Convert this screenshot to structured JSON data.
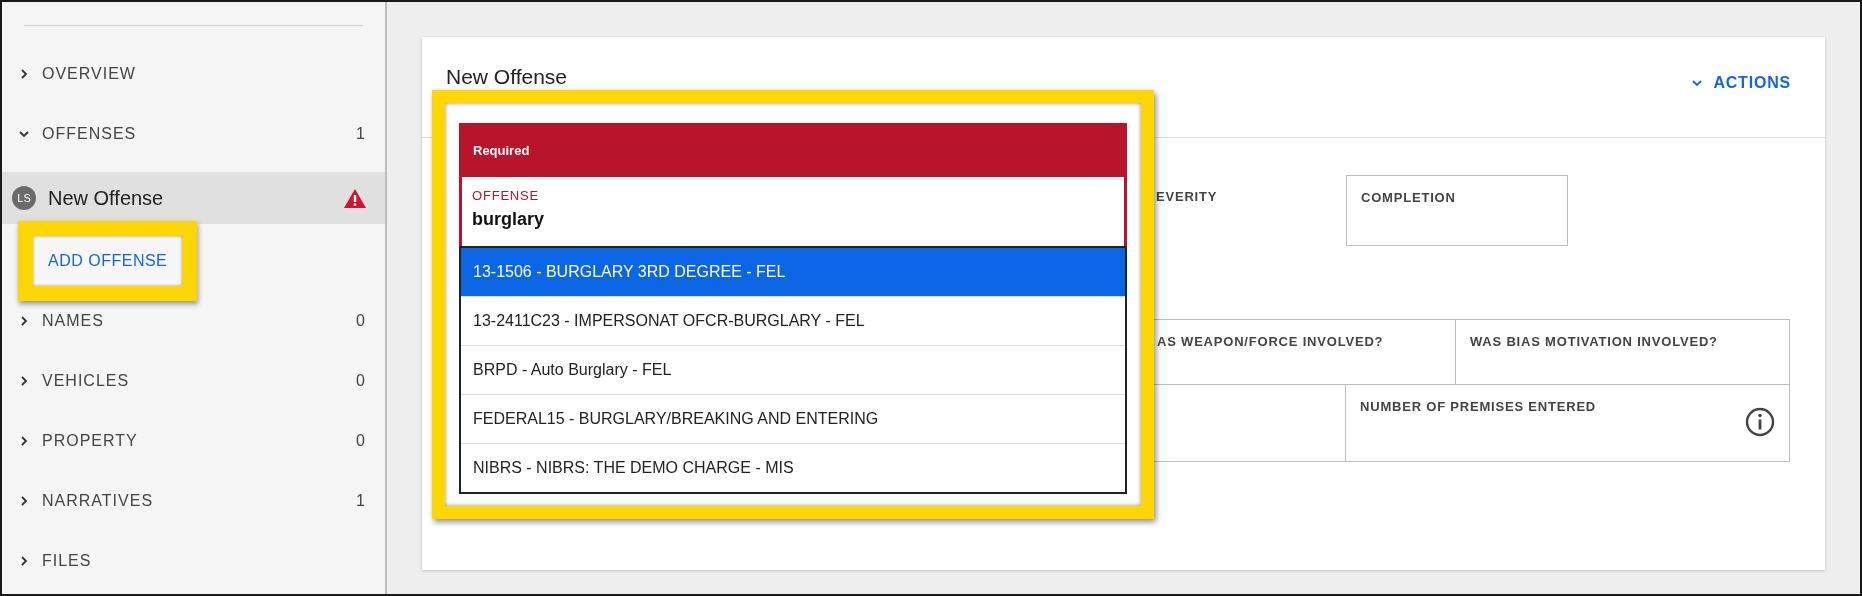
{
  "sidebar": {
    "sections": [
      {
        "label": "OVERVIEW",
        "expanded": false
      },
      {
        "label": "OFFENSES",
        "count": "1",
        "expanded": true,
        "children": [
          {
            "avatar": "LS",
            "label": "New Offense",
            "selected": true,
            "warning": true
          }
        ],
        "action": {
          "label": "ADD OFFENSE",
          "highlighted": true
        }
      },
      {
        "label": "NAMES",
        "count": "0",
        "expanded": false
      },
      {
        "label": "VEHICLES",
        "count": "0",
        "expanded": false
      },
      {
        "label": "PROPERTY",
        "count": "0",
        "expanded": false
      },
      {
        "label": "NARRATIVES",
        "count": "1",
        "expanded": false
      },
      {
        "label": "FILES",
        "expanded": false
      }
    ]
  },
  "card": {
    "title": "New Offense",
    "actions_button": "ACTIONS",
    "rows": [
      [
        {
          "label": "EVERITY",
          "bordered": false
        },
        {
          "label": "COMPLETION",
          "bordered": true
        }
      ],
      [
        {
          "label": "AS WEAPON/FORCE INVOLVED?",
          "bordered": true
        },
        {
          "label": "WAS BIAS MOTIVATION INVOLVED?",
          "bordered": true
        }
      ],
      [
        {
          "bordered": true
        },
        {
          "label": "NUMBER OF PREMISES ENTERED",
          "bordered": true,
          "info": true
        }
      ]
    ]
  },
  "offense_picker": {
    "highlighted": true,
    "error": "Required",
    "label": "OFFENSE",
    "value": "burglary",
    "options": [
      {
        "label": "13-1506 - BURGLARY 3RD DEGREE - FEL",
        "selected": true
      },
      {
        "label": "13-2411C23 - IMPERSONAT OFCR-BURGLARY - FEL",
        "selected": false
      },
      {
        "label": "BRPD - Auto Burglary - FEL",
        "selected": false
      },
      {
        "label": "FEDERAL15 - BURGLARY/BREAKING AND ENTERING",
        "selected": false
      },
      {
        "label": "NIBRS - NIBRS: THE DEMO CHARGE - MIS",
        "selected": false
      }
    ]
  }
}
